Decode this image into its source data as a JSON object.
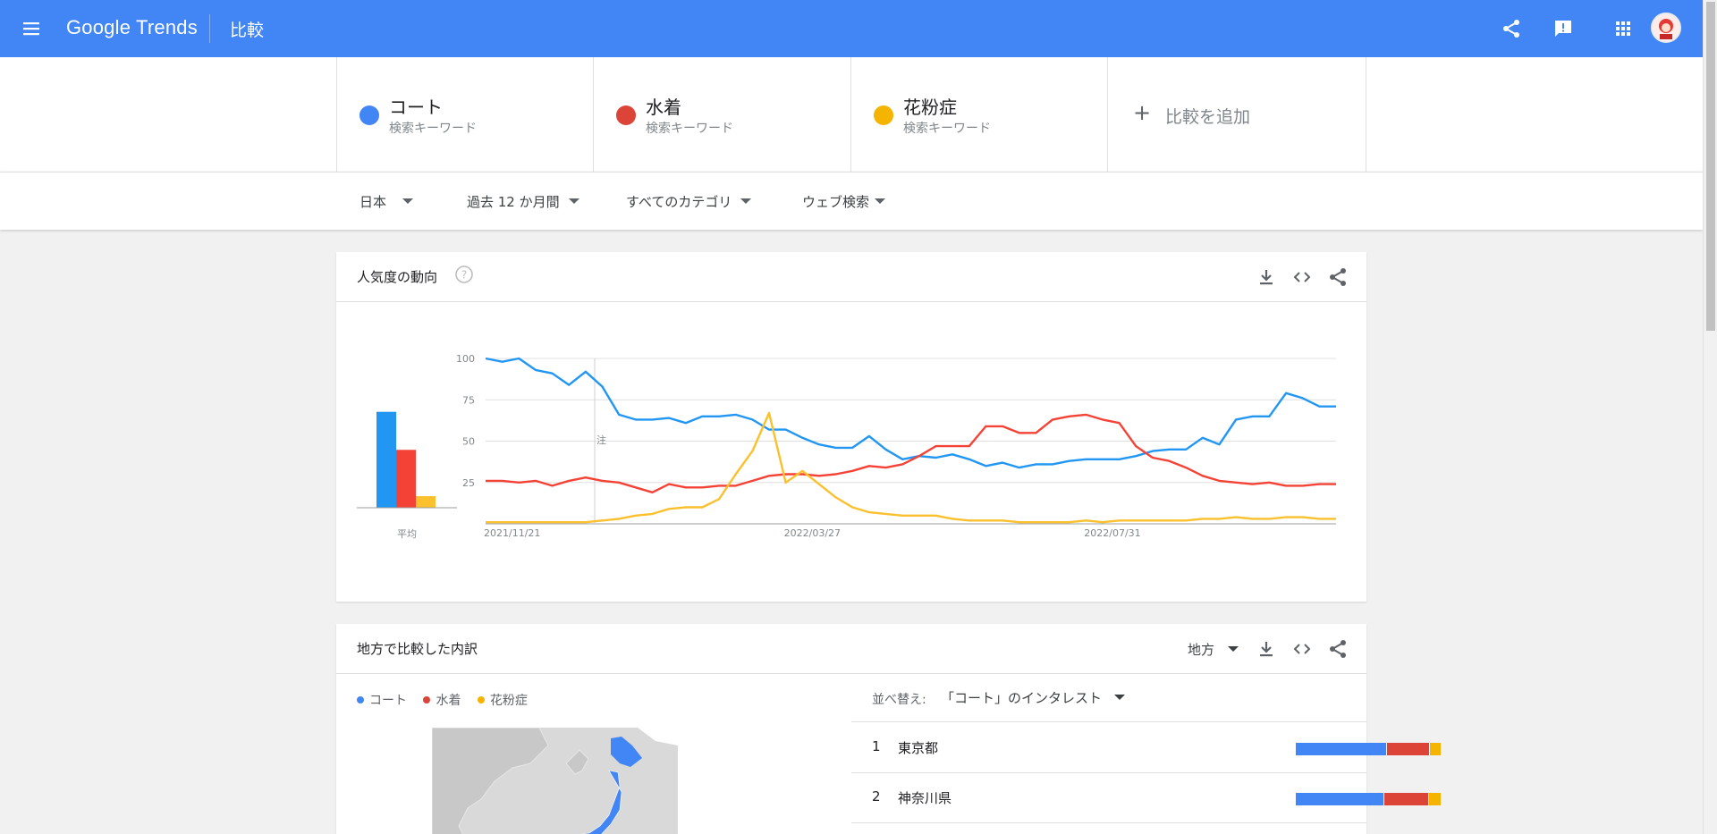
{
  "app": {
    "logo": "Google Trends",
    "page_title": "比較"
  },
  "keywords": [
    {
      "term": "コート",
      "sub": "検索キーワード",
      "color": "#4285f4"
    },
    {
      "term": "水着",
      "sub": "検索キーワード",
      "color": "#db4437"
    },
    {
      "term": "花粉症",
      "sub": "検索キーワード",
      "color": "#f4b400"
    }
  ],
  "add_compare": {
    "label": "比較を追加"
  },
  "filters": {
    "region": "日本",
    "period": "過去 12 か月間",
    "category": "すべてのカテゴリ",
    "search_type": "ウェブ検索"
  },
  "interest_card": {
    "title": "人気度の動向",
    "average_label": "平均",
    "note_label": "注"
  },
  "chart_data": {
    "type": "line",
    "x": [
      "2021/11/21",
      "2021/11/28",
      "2021/12/05",
      "2021/12/12",
      "2021/12/19",
      "2021/12/26",
      "2022/01/02",
      "2022/01/09",
      "2022/01/16",
      "2022/01/23",
      "2022/01/30",
      "2022/02/06",
      "2022/02/13",
      "2022/02/20",
      "2022/02/27",
      "2022/03/06",
      "2022/03/13",
      "2022/03/20",
      "2022/03/27",
      "2022/04/03",
      "2022/04/10",
      "2022/04/17",
      "2022/04/24",
      "2022/05/01",
      "2022/05/08",
      "2022/05/15",
      "2022/05/22",
      "2022/05/29",
      "2022/06/05",
      "2022/06/12",
      "2022/06/19",
      "2022/06/26",
      "2022/07/03",
      "2022/07/10",
      "2022/07/17",
      "2022/07/24",
      "2022/07/31",
      "2022/08/07",
      "2022/08/14",
      "2022/08/21",
      "2022/08/28",
      "2022/09/04",
      "2022/09/11",
      "2022/09/18",
      "2022/09/25",
      "2022/10/02",
      "2022/10/09",
      "2022/10/16",
      "2022/10/23",
      "2022/10/30",
      "2022/11/06",
      "2022/11/13"
    ],
    "x_tick_labels": [
      "2021/11/21",
      "2022/03/27",
      "2022/07/31"
    ],
    "y_ticks": [
      25,
      50,
      75,
      100
    ],
    "ylim": [
      0,
      100
    ],
    "grid": true,
    "series": [
      {
        "name": "コート",
        "color": "#2196f3",
        "values": [
          100,
          98,
          100,
          93,
          91,
          84,
          92,
          83,
          66,
          63,
          63,
          64,
          61,
          65,
          65,
          66,
          63,
          57,
          57,
          52,
          48,
          46,
          46,
          53,
          45,
          39,
          41,
          40,
          42,
          39,
          35,
          37,
          34,
          36,
          36,
          38,
          39,
          39,
          39,
          41,
          44,
          45,
          45,
          52,
          48,
          63,
          65,
          65,
          79,
          76,
          71,
          71
        ]
      },
      {
        "name": "水着",
        "color": "#f44336",
        "values": [
          26,
          26,
          25,
          26,
          23,
          26,
          28,
          26,
          25,
          22,
          19,
          24,
          22,
          22,
          23,
          23,
          26,
          29,
          30,
          30,
          29,
          30,
          32,
          35,
          34,
          36,
          41,
          47,
          47,
          47,
          59,
          59,
          55,
          55,
          63,
          65,
          66,
          63,
          61,
          47,
          40,
          38,
          34,
          29,
          26,
          25,
          24,
          25,
          23,
          23,
          24,
          24
        ]
      },
      {
        "name": "花粉症",
        "color": "#fbc02d",
        "values": [
          1,
          1,
          1,
          1,
          1,
          1,
          1,
          2,
          3,
          5,
          6,
          9,
          10,
          10,
          15,
          30,
          44,
          67,
          25,
          32,
          24,
          16,
          10,
          7,
          6,
          5,
          5,
          5,
          3,
          2,
          2,
          2,
          1,
          1,
          1,
          1,
          2,
          1,
          2,
          2,
          2,
          2,
          2,
          3,
          3,
          4,
          3,
          3,
          4,
          4,
          3,
          3
        ]
      }
    ],
    "averages": [
      {
        "name": "コート",
        "value": 58,
        "color": "#2196f3"
      },
      {
        "name": "水着",
        "value": 35,
        "color": "#f44336"
      },
      {
        "name": "花粉症",
        "value": 7,
        "color": "#fbc02d"
      }
    ]
  },
  "region_card": {
    "title": "地方で比較した内訳",
    "resolution": "地方",
    "legend": [
      "コート",
      "水着",
      "花粉症"
    ],
    "sort_label": "並べ替え:",
    "sort_value": "「コート」のインタレスト",
    "rows": [
      {
        "rank": "1",
        "name": "東京都",
        "shares": [
          60,
          28,
          7
        ]
      },
      {
        "rank": "2",
        "name": "神奈川県",
        "shares": [
          58,
          29,
          8
        ]
      }
    ]
  },
  "colors": {
    "brand": "#4285f4",
    "blue": "#4285f4",
    "red": "#db4437",
    "yellow": "#f4b400"
  }
}
